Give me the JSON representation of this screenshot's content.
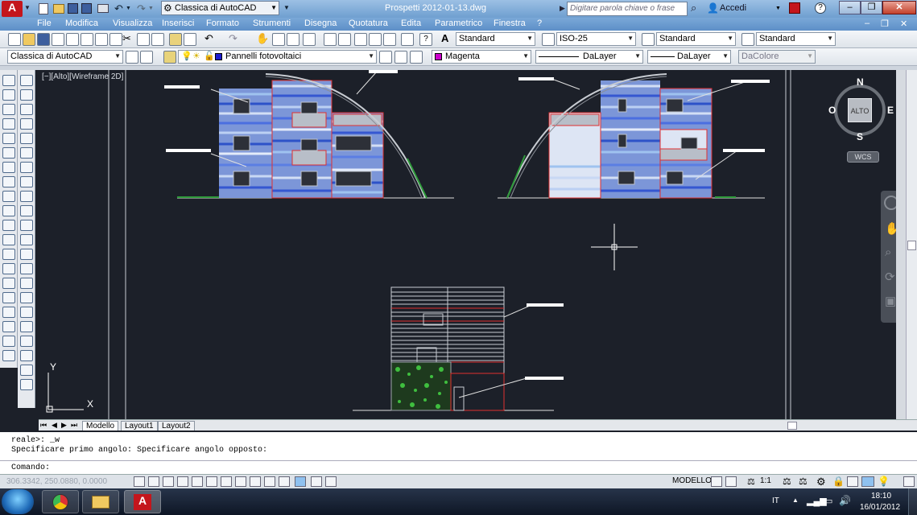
{
  "titlebar": {
    "workspace": "Classica di AutoCAD",
    "file_title": "Prospetti 2012-01-13.dwg",
    "search_placeholder": "Digitare parola chiave o frase",
    "signin": "Accedi"
  },
  "menu": [
    "File",
    "Modifica",
    "Visualizza",
    "Inserisci",
    "Formato",
    "Strumenti",
    "Disegna",
    "Quotatura",
    "Edita",
    "Parametrico",
    "Finestra",
    "?"
  ],
  "toolbar1": {
    "text_style": "Standard",
    "dim_style": "ISO-25",
    "table_style": "Standard",
    "mleader_style": "Standard"
  },
  "toolbar2": {
    "workspace": "Classica di AutoCAD",
    "layer": "Pannelli fotovoltaici",
    "color": "Magenta",
    "color_hex": "#cc00cc",
    "linetype": "DaLayer",
    "lineweight": "DaLayer",
    "plotstyle": "DaColore"
  },
  "viewport": {
    "label": "[−][Alto][Wireframe 2D]",
    "viewcube": {
      "n": "N",
      "s": "S",
      "e": "E",
      "w": "O",
      "top": "ALTO"
    },
    "wcs": "WCS",
    "ucs_x": "X",
    "ucs_y": "Y"
  },
  "layout_tabs": [
    "Modello",
    "Layout1",
    "Layout2"
  ],
  "command": {
    "line1": "reale>: _w",
    "line2": "Specificare primo angolo: Specificare angolo opposto:",
    "prompt": "Comando:"
  },
  "status": {
    "coords": "306.3342, 250.0880, 0.0000",
    "model": "MODELLO",
    "scale": "1:1"
  },
  "taskbar": {
    "lang": "IT",
    "time": "18:10",
    "date": "16/01/2012"
  }
}
